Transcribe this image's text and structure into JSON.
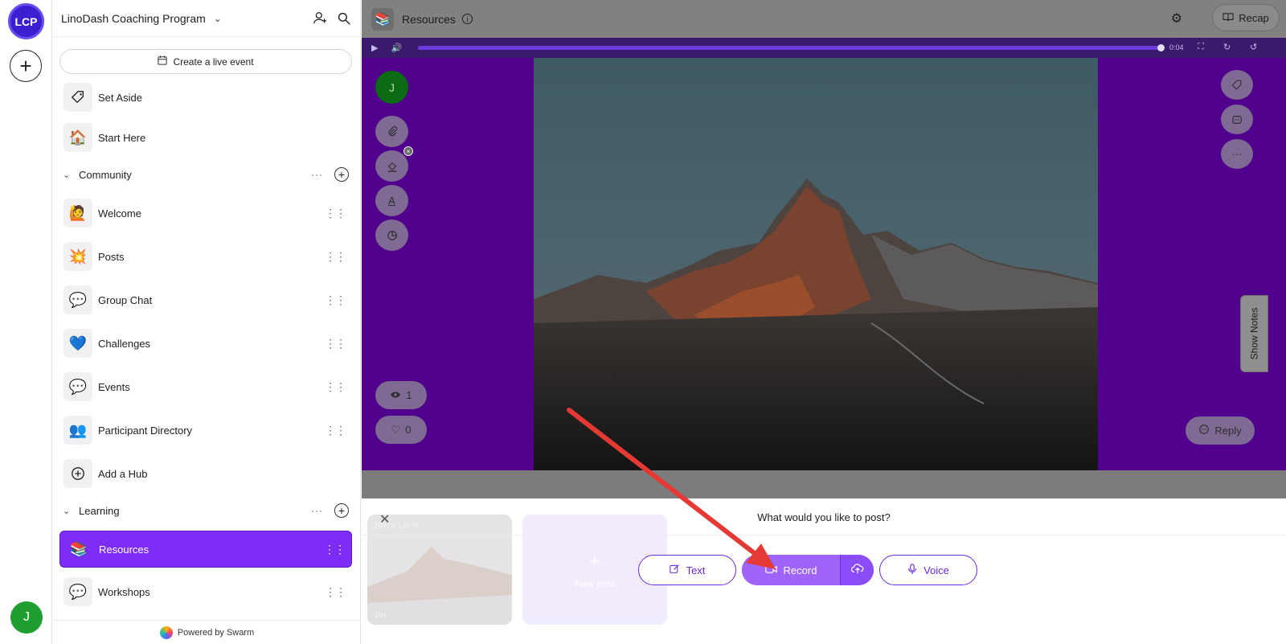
{
  "rail": {
    "org_initials": "LCP",
    "user_initial": "J"
  },
  "sidebar": {
    "title": "LinoDash Coaching Program",
    "live_event_label": "Create a live event",
    "top_items": [
      {
        "label": "Set Aside",
        "icon": "tag-icon"
      },
      {
        "label": "Start Here",
        "icon": "house-icon"
      }
    ],
    "community": {
      "label": "Community",
      "items": [
        {
          "label": "Welcome",
          "icon": "person-raising-hand-icon"
        },
        {
          "label": "Posts",
          "icon": "collision-icon"
        },
        {
          "label": "Group Chat",
          "icon": "speech-bubble-icon"
        },
        {
          "label": "Challenges",
          "icon": "blue-heart-icon"
        },
        {
          "label": "Events",
          "icon": "speech-bubble-icon"
        },
        {
          "label": "Participant Directory",
          "icon": "people-icon"
        },
        {
          "label": "Add a Hub",
          "icon": "plus-circle-icon"
        }
      ]
    },
    "learning": {
      "label": "Learning",
      "items": [
        {
          "label": "Resources",
          "icon": "books-icon",
          "active": true
        },
        {
          "label": "Workshops",
          "icon": "speech-bubble-icon"
        }
      ]
    },
    "powered_by": "Powered by Swarm"
  },
  "main": {
    "title": "Resources",
    "recap_label": "Recap",
    "player": {
      "time": "0:04"
    },
    "author_initial": "J",
    "views": "1",
    "likes": "0",
    "reply_label": "Reply",
    "show_notes_label": "Show Notes"
  },
  "composer": {
    "prompt": "What would you like to post?",
    "ghost_card_name": "Brent Lin N",
    "ghost_card_time": "2m",
    "new_post_label": "New post",
    "text_label": "Text",
    "record_label": "Record",
    "voice_label": "Voice"
  },
  "colors": {
    "accent": "#7d2cf6",
    "stage": "#51008d",
    "annotation_arrow": "#e53935"
  }
}
